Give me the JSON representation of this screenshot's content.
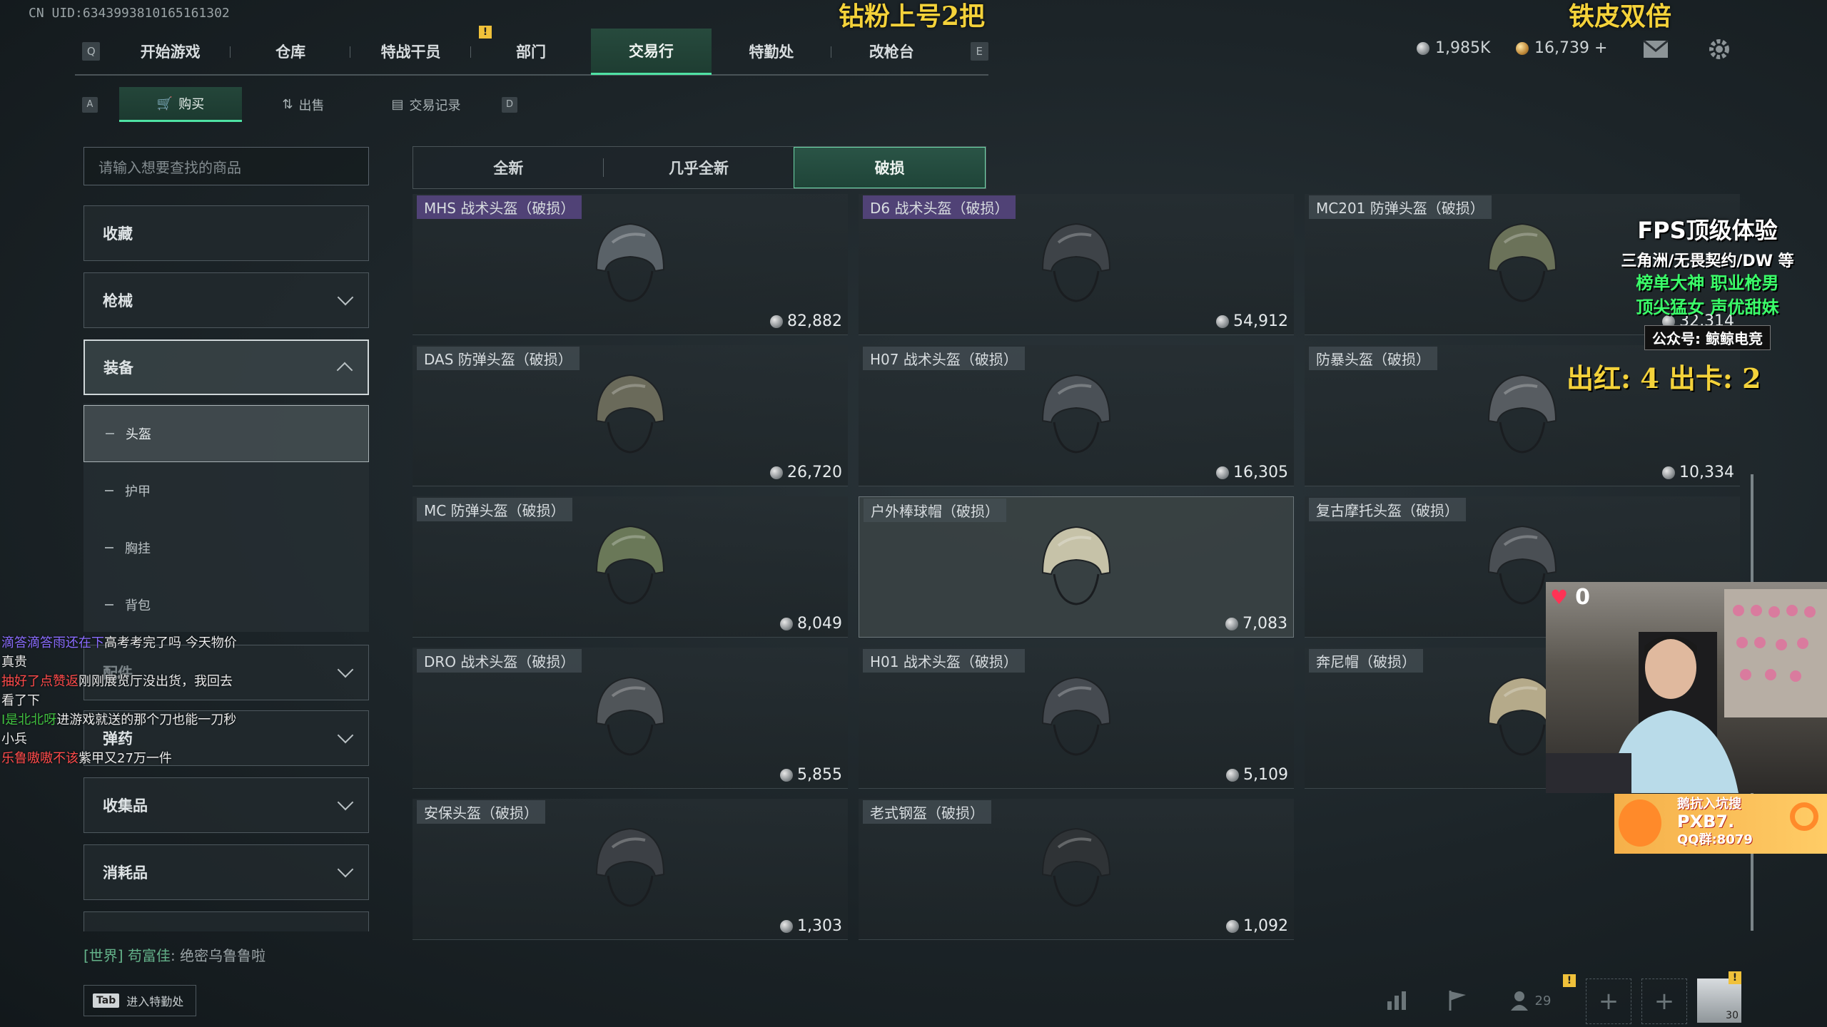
{
  "uid": "CN UID:634399381016516130​2",
  "overlay": {
    "top_center": "钻粉上号2把",
    "top_right": "铁皮双倍",
    "counts": "出红: 4 出卡: 2"
  },
  "topnav": {
    "left_key": "Q",
    "right_key": "E",
    "tabs": [
      "开始游戏",
      "仓库",
      "特战干员",
      "部门",
      "交易行",
      "特勤处",
      "改枪台"
    ],
    "active": "交易行",
    "notice": "!"
  },
  "currency": {
    "silver": "1,985K",
    "gold": "16,739 +"
  },
  "subnav": {
    "left_key": "A",
    "right_key": "D",
    "tabs": [
      "购买",
      "出售",
      "交易记录"
    ],
    "active": "购买"
  },
  "search": {
    "placeholder": "请输入想要查找的商品"
  },
  "categories": [
    {
      "label": "收藏"
    },
    {
      "label": "枪械"
    },
    {
      "label": "装备",
      "expanded": true
    },
    {
      "label": "配件"
    },
    {
      "label": "弹药"
    },
    {
      "label": "收集品"
    },
    {
      "label": "消耗品"
    }
  ],
  "subcategories": [
    "头盔",
    "护甲",
    "胸挂",
    "背包"
  ],
  "condition_tabs": [
    "全新",
    "几乎全新",
    "破损"
  ],
  "condition_active": "破损",
  "items": [
    {
      "name": "MHS 战术头盔（破损）",
      "price": "82,882",
      "rarity": "purple"
    },
    {
      "name": "D6 战术头盔（破损）",
      "price": "54,912",
      "rarity": "purple"
    },
    {
      "name": "MC201 防弹头盔（破损）",
      "price": "32,314",
      "rarity": "normal"
    },
    {
      "name": "DAS 防弹头盔（破损）",
      "price": "26,720",
      "rarity": "normal"
    },
    {
      "name": "H07 战术头盔（破损）",
      "price": "16,305",
      "rarity": "normal"
    },
    {
      "name": "防暴头盔（破损）",
      "price": "10,334",
      "rarity": "normal"
    },
    {
      "name": "MC 防弹头盔（破损）",
      "price": "8,049",
      "rarity": "normal"
    },
    {
      "name": "户外棒球帽（破损）",
      "price": "7,083",
      "rarity": "normal"
    },
    {
      "name": "复古摩托头盔（破损）",
      "price": "",
      "rarity": "normal"
    },
    {
      "name": "DRO 战术头盔（破损）",
      "price": "5,855",
      "rarity": "normal"
    },
    {
      "name": "H01 战术头盔（破损）",
      "price": "5,109",
      "rarity": "normal"
    },
    {
      "name": "奔尼帽（破损）",
      "price": "",
      "rarity": "normal"
    },
    {
      "name": "安保头盔（破损）",
      "price": "1,303",
      "rarity": "normal"
    },
    {
      "name": "老式钢盔（破损）",
      "price": "1,092",
      "rarity": "normal"
    }
  ],
  "chat": [
    {
      "name": "滴答滴答雨还在下",
      "text": "高考考完了吗 今天物价",
      "color": "purple"
    },
    {
      "name": "",
      "text": "真贵",
      "color": ""
    },
    {
      "name": "抽好了点赞返",
      "text": "刚刚展览厅没出货，我回去",
      "color": "red"
    },
    {
      "name": "",
      "text": "看了下",
      "color": ""
    },
    {
      "name": "I是北北呀",
      "text": "进游戏就送的那个刀也能一刀秒",
      "color": "green"
    },
    {
      "name": "",
      "text": "小兵",
      "color": ""
    },
    {
      "name": "乐鲁嗷嗷不该",
      "text": "紫甲又27万一件",
      "color": "red"
    }
  ],
  "promo": {
    "title": "FPS顶级体验",
    "sub": "三角洲/无畏契约/DW 等",
    "line1": "榜单大神  职业枪男",
    "line2": "顶尖猛女  声优甜妹",
    "badge": "公众号: 鲸鲸电竞"
  },
  "webcam": {
    "heart_count": "0"
  },
  "ad": {
    "line1": "鹅抗入坑搜",
    "line2": "PXB7.",
    "line3": "QQ群:8079"
  },
  "world_chat": {
    "tag": "[世界]",
    "name": "苟富佳",
    "text": "绝密乌鲁鲁啦"
  },
  "bottom": {
    "tab_key": "Tab",
    "tab_hint": "进入特勤处",
    "friends_count": "29",
    "level": "30"
  }
}
